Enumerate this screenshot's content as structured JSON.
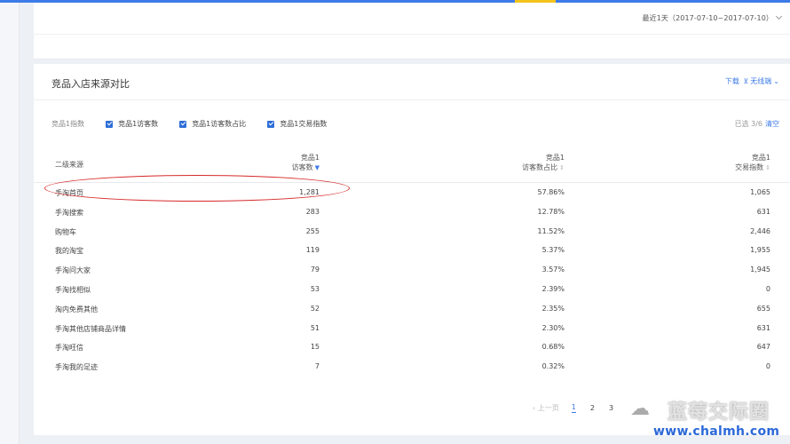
{
  "header": {
    "date_range": "最近1天（2017-07-10~2017-07-10）"
  },
  "panel": {
    "title": "竞品入店来源对比",
    "download": "下载",
    "wireless": "无线端"
  },
  "filters": {
    "label": "竞品1指数",
    "items": [
      "竞品1访客数",
      "竞品1访客数占比",
      "竞品1交易指数"
    ],
    "selected_info": "已选 3/6",
    "clear": "清空"
  },
  "table": {
    "headers": {
      "source": "二级来源",
      "visitors_line1": "竞品1",
      "visitors_line2": "访客数",
      "share_line1": "竞品1",
      "share_line2": "访客数占比",
      "trade_line1": "竞品1",
      "trade_line2": "交易指数"
    },
    "rows": [
      {
        "source": "手淘首页",
        "visitors": "1,281",
        "share": "57.86%",
        "trade": "1,065"
      },
      {
        "source": "手淘搜索",
        "visitors": "283",
        "share": "12.78%",
        "trade": "631"
      },
      {
        "source": "购物车",
        "visitors": "255",
        "share": "11.52%",
        "trade": "2,446"
      },
      {
        "source": "我的淘宝",
        "visitors": "119",
        "share": "5.37%",
        "trade": "1,955"
      },
      {
        "source": "手淘问大家",
        "visitors": "79",
        "share": "3.57%",
        "trade": "1,945"
      },
      {
        "source": "手淘找相似",
        "visitors": "53",
        "share": "2.39%",
        "trade": "0"
      },
      {
        "source": "淘内免费其他",
        "visitors": "52",
        "share": "2.35%",
        "trade": "655"
      },
      {
        "source": "手淘其他店铺商品详情",
        "visitors": "51",
        "share": "2.30%",
        "trade": "631"
      },
      {
        "source": "手淘旺信",
        "visitors": "15",
        "share": "0.68%",
        "trade": "647"
      },
      {
        "source": "手淘我的足迹",
        "visitors": "7",
        "share": "0.32%",
        "trade": "0"
      }
    ]
  },
  "pager": {
    "prev": "上一页",
    "pages": [
      "1",
      "2",
      "3"
    ],
    "active": "1"
  },
  "watermark": {
    "title": "蓝莓交际圈",
    "url": "www.chalmh.com"
  },
  "colors": {
    "accent": "#3d7be8",
    "highlight": "#d62a2a"
  }
}
